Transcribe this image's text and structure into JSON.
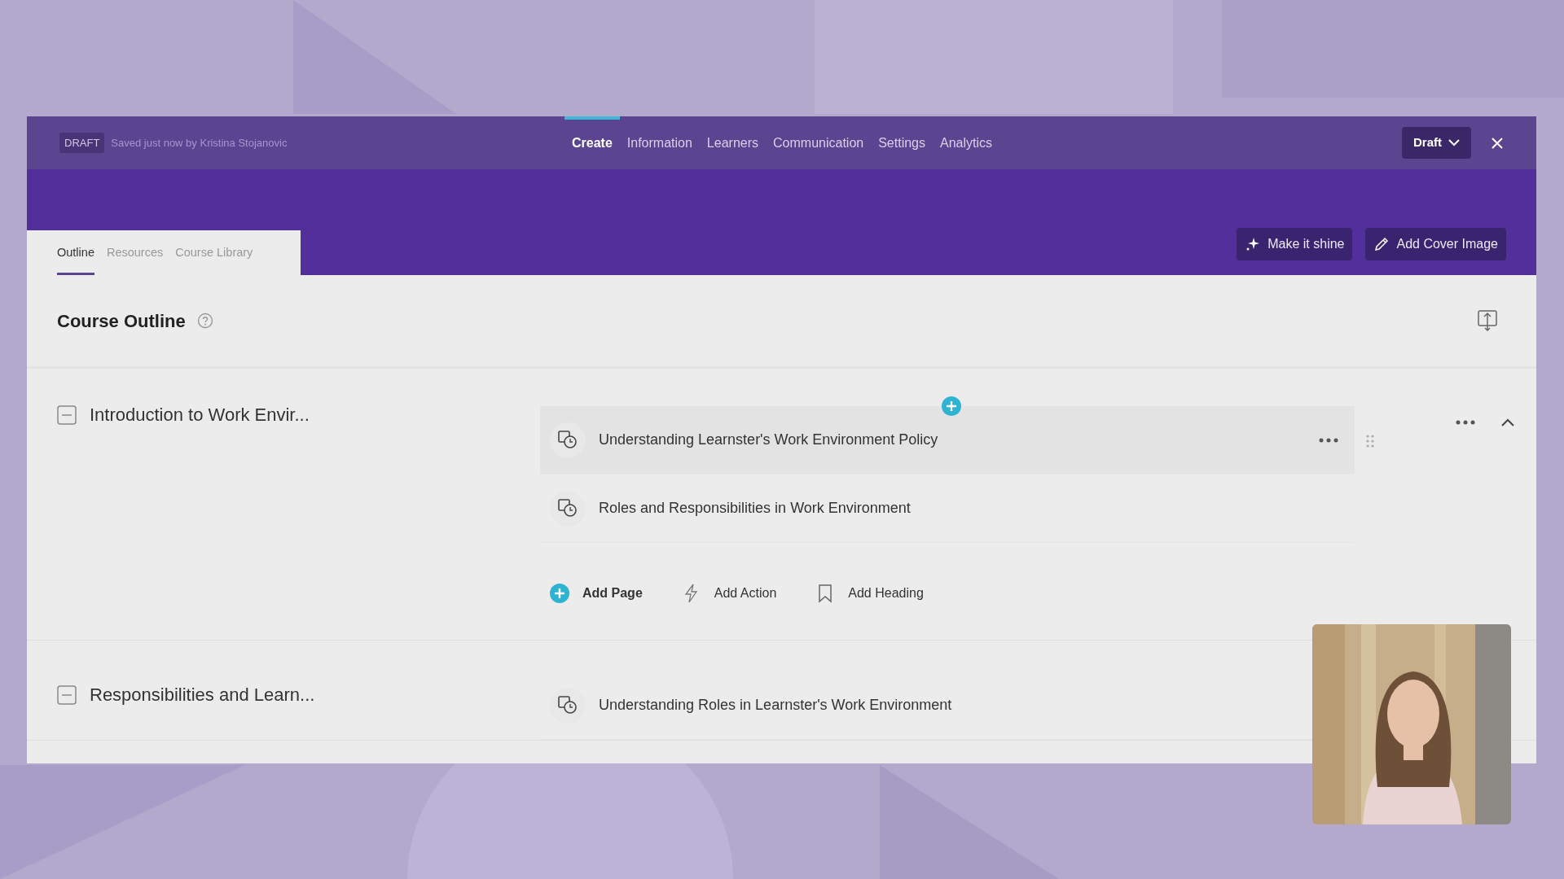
{
  "status": {
    "badge": "DRAFT",
    "saved": "Saved just now by Kristina Stojanovic"
  },
  "nav": [
    {
      "label": "Create",
      "selected": true
    },
    {
      "label": "Information",
      "selected": false
    },
    {
      "label": "Learners",
      "selected": false
    },
    {
      "label": "Communication",
      "selected": false
    },
    {
      "label": "Settings",
      "selected": false
    },
    {
      "label": "Analytics",
      "selected": false
    }
  ],
  "publish_menu": {
    "label": "Draft"
  },
  "banner_buttons": [
    {
      "kind": "sparkle",
      "label": "Make it shine"
    },
    {
      "kind": "pencil",
      "label": "Add Cover Image"
    }
  ],
  "tabs": [
    {
      "label": "Outline",
      "selected": true
    },
    {
      "label": "Resources",
      "selected": false
    },
    {
      "label": "Course Library",
      "selected": false
    }
  ],
  "outline": {
    "title": "Course Outline",
    "sections": [
      {
        "title": "Introduction to Work Envir...",
        "expanded": true,
        "highlighted": true,
        "pages": [
          {
            "title": "Understanding Learnster's Work Environment Policy",
            "highlighted": true
          },
          {
            "title": "Roles and Responsibilities in Work Environment",
            "highlighted": false
          }
        ],
        "actions": [
          {
            "kind": "page",
            "label": "Add Page"
          },
          {
            "kind": "action",
            "label": "Add Action"
          },
          {
            "kind": "heading",
            "label": "Add Heading"
          }
        ]
      },
      {
        "title": "Responsibilities and Learn...",
        "expanded": true,
        "highlighted": false,
        "pages": [
          {
            "title": "Understanding Roles in Learnster's Work Environment",
            "highlighted": false
          }
        ]
      }
    ]
  }
}
